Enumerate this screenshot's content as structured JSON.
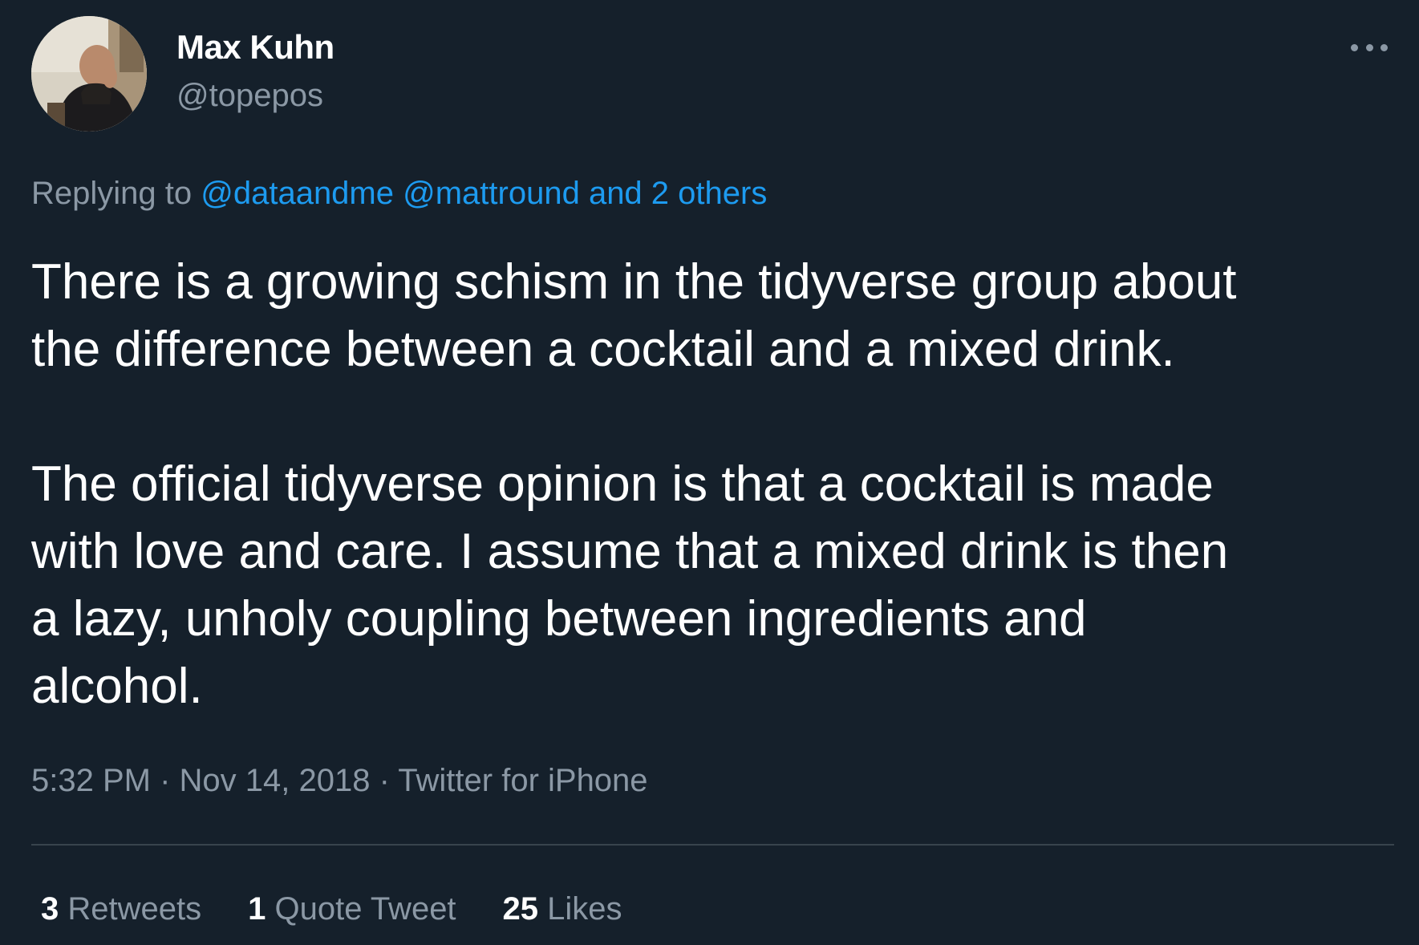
{
  "author": {
    "display_name": "Max Kuhn",
    "handle": "@topepos"
  },
  "menu": {
    "icon": "more-horizontal-icon"
  },
  "reply": {
    "prefix": "Replying to ",
    "mention_1": "@dataandme",
    "separator": " ",
    "mention_2": "@mattround",
    "others": " and 2 others"
  },
  "content": {
    "paragraph_1": "There is a growing schism in the tidyverse group about\nthe difference between a cocktail and a mixed drink.",
    "paragraph_2": "The official tidyverse opinion is that a cocktail is made\nwith love and care. I assume that a mixed drink is then\na lazy, unholy coupling between ingredients and\nalcohol."
  },
  "meta": {
    "time": "5:32 PM",
    "dot_1": " · ",
    "date": "Nov 14, 2018",
    "dot_2": " · ",
    "source": "Twitter for iPhone"
  },
  "stats": {
    "retweets_count": "3",
    "retweets_label": " Retweets",
    "quotes_count": "1",
    "quotes_label": " Quote Tweet",
    "likes_count": "25",
    "likes_label": " Likes"
  },
  "colors": {
    "background": "#15202b",
    "primary_text": "#ffffff",
    "secondary_text": "#8b98a5",
    "link": "#1d9bf0",
    "divider": "#38444d"
  }
}
